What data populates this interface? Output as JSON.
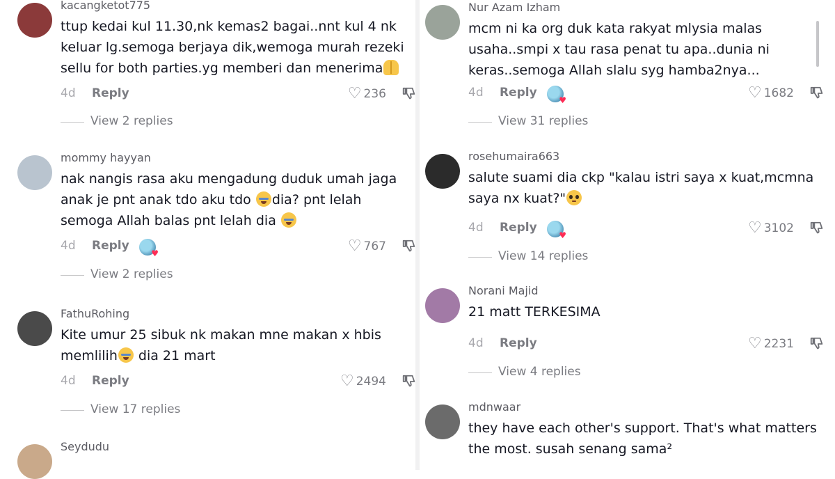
{
  "left": [
    {
      "username": "kacangketot775",
      "segments": [
        {
          "t": "ttup kedai kul 11.30,nk kemas2 bagai..nnt kul 4 nk keluar lg.semoga berjaya dik,wemoga murah rezeki sellu for both parties.yg memberi dan menerima"
        },
        {
          "emoji": "open-hands-icon"
        }
      ],
      "date": "4d",
      "reply": "Reply",
      "creator_liked": false,
      "likes": "236",
      "view_replies": "View 2 replies",
      "avatar": "#8b3a3a"
    },
    {
      "username": "mommy hayyan",
      "segments": [
        {
          "t": "nak nangis rasa aku mengadung duduk umah jaga anak je pnt anak tdo aku tdo "
        },
        {
          "emoji": "loudly-crying-icon"
        },
        {
          "t": "dia? pnt lelah semoga Allah balas pnt lelah dia "
        },
        {
          "emoji": "loudly-crying-icon"
        }
      ],
      "date": "4d",
      "reply": "Reply",
      "creator_liked": true,
      "likes": "767",
      "view_replies": "View 2 replies",
      "avatar": "#b9c4cf"
    },
    {
      "username": "FathuRohing",
      "segments": [
        {
          "t": "Kite umur 25 sibuk nk makan mne makan x hbis memlilih"
        },
        {
          "emoji": "loudly-crying-icon"
        },
        {
          "t": " dia 21 mart"
        }
      ],
      "date": "4d",
      "reply": "Reply",
      "creator_liked": false,
      "likes": "2494",
      "view_replies": "View 17 replies",
      "avatar": "#4a4a4a"
    },
    {
      "username": "Seydudu",
      "segments": [],
      "avatar": "#c9a98a"
    }
  ],
  "right": [
    {
      "username": "Nur Azam Izham",
      "segments": [
        {
          "t": "mcm ni ka org duk kata rakyat mlysia malas usaha..smpi x tau rasa penat tu apa..dunia ni keras..semoga Allah slalu syg hamba2nya..."
        }
      ],
      "date": "4d",
      "reply": "Reply",
      "creator_liked": true,
      "likes": "1682",
      "view_replies": "View 31 replies",
      "avatar": "#9aa39a"
    },
    {
      "username": "rosehumaira663",
      "segments": [
        {
          "t": "salute suami dia ckp \"kalau istri saya x kuat,mcmna saya nx kuat?\""
        },
        {
          "emoji": "pleading-face-icon"
        }
      ],
      "date": "4d",
      "reply": "Reply",
      "creator_liked": true,
      "likes": "3102",
      "view_replies": "View 14 replies",
      "avatar": "#2b2b2b"
    },
    {
      "username": "Norani Majid",
      "segments": [
        {
          "t": "21 matt TERKESIMA"
        }
      ],
      "date": "4d",
      "reply": "Reply",
      "creator_liked": false,
      "likes": "2231",
      "view_replies": "View 4 replies",
      "avatar": "#a27aa6"
    },
    {
      "username": "mdnwaar",
      "segments": [
        {
          "t": "they have each other's support. That's what matters the most. susah senang sama²"
        }
      ],
      "avatar": "#6b6b6b"
    }
  ]
}
